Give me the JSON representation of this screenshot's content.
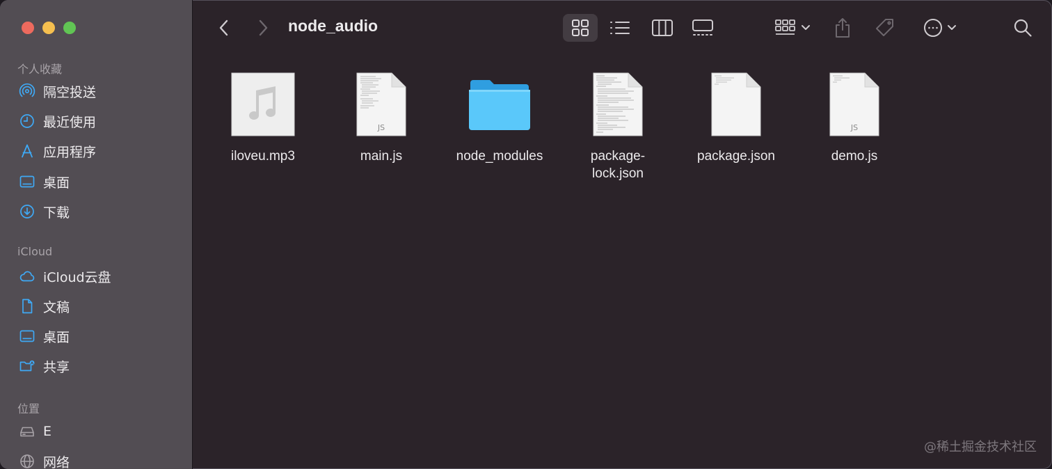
{
  "window": {
    "title": "node_audio"
  },
  "sidebar": {
    "sections": [
      {
        "title": "个人收藏"
      },
      {
        "title": "iCloud"
      },
      {
        "title": "位置"
      }
    ],
    "favorites": [
      {
        "label": "隔空投送",
        "icon": "airdrop-icon"
      },
      {
        "label": "最近使用",
        "icon": "clock-icon"
      },
      {
        "label": "应用程序",
        "icon": "applications-icon"
      },
      {
        "label": "桌面",
        "icon": "desktop-icon"
      },
      {
        "label": "下载",
        "icon": "download-icon"
      }
    ],
    "icloud": [
      {
        "label": "iCloud云盘",
        "icon": "cloud-icon"
      },
      {
        "label": "文稿",
        "icon": "document-icon"
      },
      {
        "label": "桌面",
        "icon": "desktop-icon"
      },
      {
        "label": "共享",
        "icon": "shared-folder-icon"
      }
    ],
    "locations": [
      {
        "label": "E",
        "icon": "drive-icon"
      },
      {
        "label": "网络",
        "icon": "network-icon"
      }
    ]
  },
  "toolbar": {
    "back": "back-chevron-icon",
    "forward": "forward-chevron-icon",
    "views": [
      "icon-view",
      "list-view",
      "column-view",
      "gallery-view"
    ],
    "active_view": "icon-view"
  },
  "files": [
    {
      "name": "iloveu.mp3",
      "kind": "audio"
    },
    {
      "name": "main.js",
      "kind": "js",
      "badge": "JS"
    },
    {
      "name": "node_modules",
      "kind": "folder"
    },
    {
      "name": "package-lock.json",
      "kind": "text"
    },
    {
      "name": "package.json",
      "kind": "blank"
    },
    {
      "name": "demo.js",
      "kind": "js",
      "badge": "JS"
    }
  ],
  "watermark": "@稀土掘金技术社区",
  "colors": {
    "accent": "#3fa9f5",
    "folder": "#5ac8fa"
  }
}
